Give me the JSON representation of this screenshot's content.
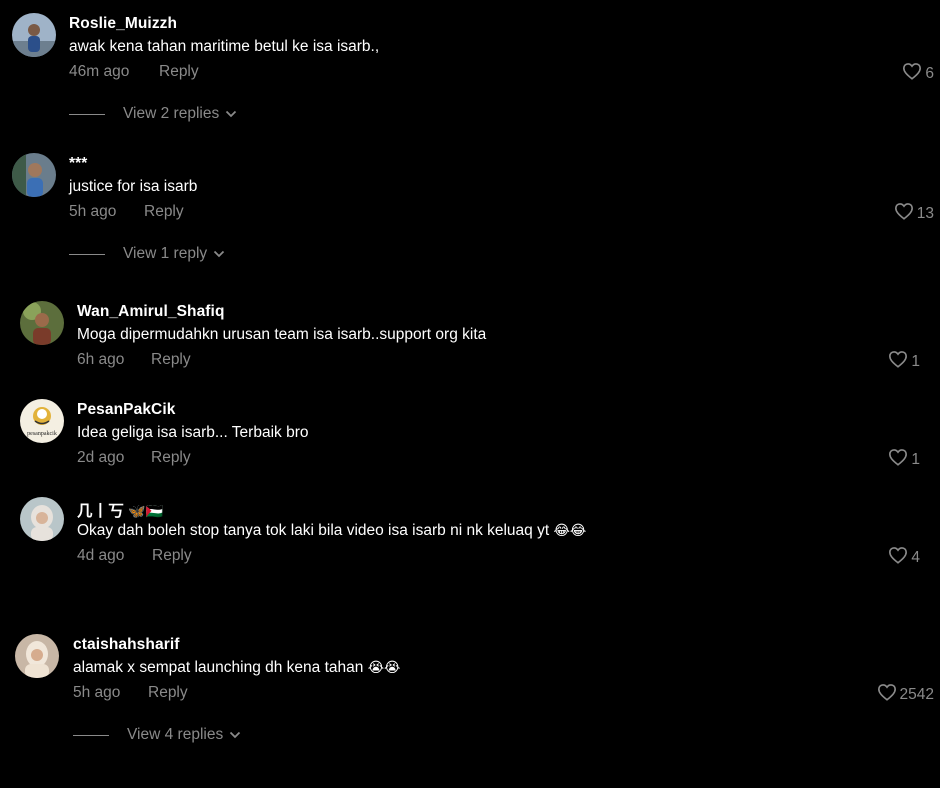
{
  "colors": {
    "background": "#000000",
    "primary_text": "#ffffff",
    "secondary_text": "#8a8a8a"
  },
  "reply_label": "Reply",
  "comments": [
    {
      "username": "Roslie_Muizzh",
      "text": "awak kena tahan maritime betul ke isa isarb.,",
      "time": "46m ago",
      "likes": "6",
      "view_replies": "View 2 replies"
    },
    {
      "username": "***",
      "text": "justice for isa isarb",
      "time": "5h ago",
      "likes": "13",
      "view_replies": "View 1 reply"
    },
    {
      "username": "Wan_Amirul_Shafiq",
      "text": "Moga dipermudahkn urusan team isa isarb..support org kita",
      "time": "6h ago",
      "likes": "1"
    },
    {
      "username": "PesanPakCik",
      "text": "Idea geliga isa isarb... Terbaik bro",
      "time": "2d ago",
      "likes": "1",
      "avatar_logo_text": "pesanpakcik"
    },
    {
      "username": "几丨丂",
      "username_emoji": "🦋🇵🇸",
      "text": "Okay dah boleh stop tanya tok laki bila video isa isarb ni nk keluaq yt",
      "text_emoji": "😂😂",
      "time": "4d ago",
      "likes": "4"
    },
    {
      "username": "ctaishahsharif",
      "text": "alamak x sempat launching dh kena tahan",
      "text_emoji": "😭😭",
      "time": "5h ago",
      "likes": "2542",
      "view_replies": "View 4 replies"
    }
  ]
}
